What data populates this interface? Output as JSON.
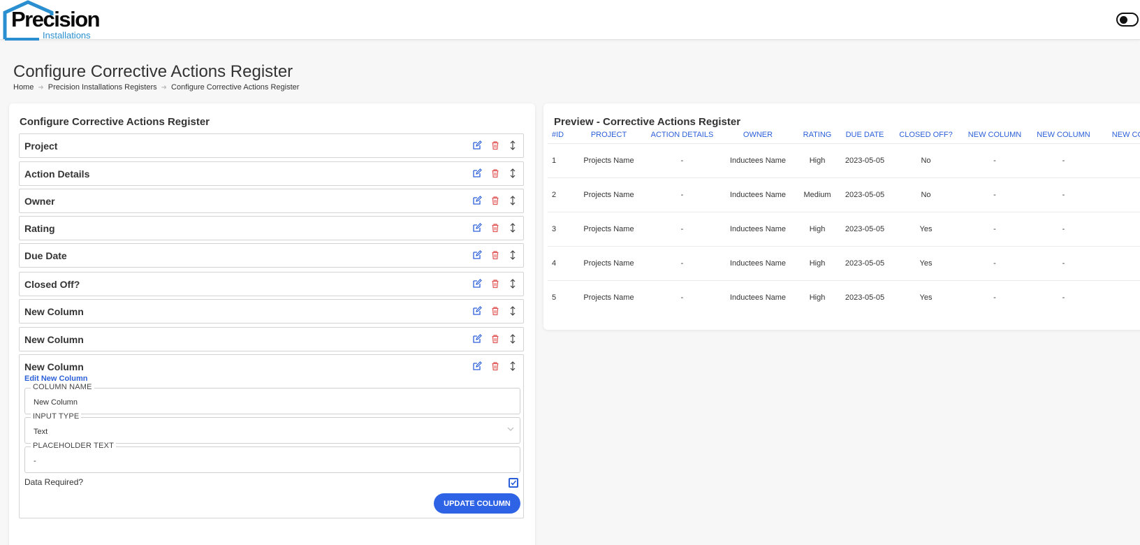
{
  "brand": {
    "name": "Precision",
    "sub": "Installations"
  },
  "page": {
    "title": "Configure Corrective Actions Register"
  },
  "breadcrumb": [
    "Home",
    "Precision Installations Registers",
    "Configure Corrective Actions Register"
  ],
  "config": {
    "title": "Configure Corrective Actions Register",
    "columns": [
      "Project",
      "Action Details",
      "Owner",
      "Rating",
      "Due Date",
      "Closed Off?",
      "New Column",
      "New Column",
      "New Column"
    ],
    "editor": {
      "heading": "Edit New Column",
      "column_name_label": "COLUMN NAME",
      "column_name_value": "New Column",
      "input_type_label": "INPUT TYPE",
      "input_type_value": "Text",
      "placeholder_label": "PLACEHOLDER TEXT",
      "placeholder_value": "-",
      "required_label": "Data Required?",
      "required_checked": true,
      "update_label": "UPDATE COLUMN"
    }
  },
  "preview": {
    "title": "Preview - Corrective Actions Register",
    "headers": [
      "#ID",
      "PROJECT",
      "ACTION DETAILS",
      "OWNER",
      "RATING",
      "DUE DATE",
      "CLOSED OFF?",
      "NEW COLUMN",
      "NEW COLUMN",
      "NEW COLUMN"
    ],
    "rows": [
      [
        "1",
        "Projects Name",
        "-",
        "Inductees Name",
        "High",
        "2023-05-05",
        "No",
        "-",
        "-",
        ""
      ],
      [
        "2",
        "Projects Name",
        "-",
        "Inductees Name",
        "Medium",
        "2023-05-05",
        "No",
        "-",
        "-",
        ""
      ],
      [
        "3",
        "Projects Name",
        "-",
        "Inductees Name",
        "High",
        "2023-05-05",
        "Yes",
        "-",
        "-",
        ""
      ],
      [
        "4",
        "Projects Name",
        "-",
        "Inductees Name",
        "High",
        "2023-05-05",
        "Yes",
        "-",
        "-",
        ""
      ],
      [
        "5",
        "Projects Name",
        "-",
        "Inductees Name",
        "High",
        "2023-05-05",
        "Yes",
        "-",
        "-",
        ""
      ]
    ]
  },
  "colors": {
    "accent": "#2f63e6",
    "link": "#2b5fd9",
    "danger": "#e05757",
    "logo_blue": "#2a8fd0"
  }
}
